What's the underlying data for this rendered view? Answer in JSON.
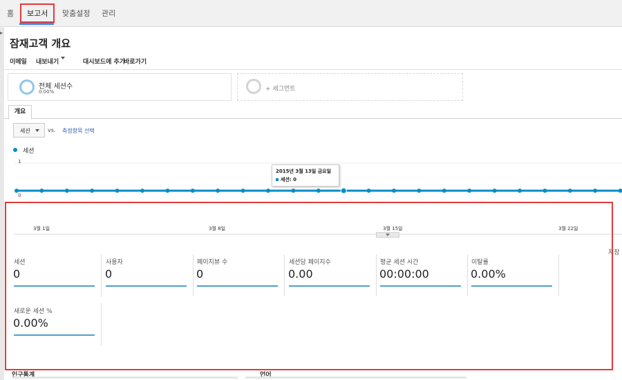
{
  "nav": {
    "tabs": [
      {
        "label": "홈"
      },
      {
        "label": "보고서"
      },
      {
        "label": "맞춤설정"
      },
      {
        "label": "관리"
      }
    ],
    "active_tab": "보고서",
    "accent_color": "#4285f4",
    "highlight_color": "#e53935"
  },
  "page": {
    "title": "잠재고객 개요"
  },
  "toolbar": {
    "email": "이메일",
    "export": "내보내기",
    "add_dashboard": "대시보드에 추가",
    "shortcut": "바로가기"
  },
  "segments": {
    "main_label": "전체 세션수",
    "main_value": "0.00%",
    "add_label": "+ 세그먼트"
  },
  "report_tabs": {
    "overview": "개요"
  },
  "chart_controls": {
    "metric": "세션",
    "vs": "vs.",
    "choose_metric": "측정항목 선택"
  },
  "chart_data": {
    "type": "line",
    "series": [
      {
        "name": "세션",
        "values": [
          0,
          0,
          0,
          0,
          0,
          0,
          0,
          0,
          0,
          0,
          0,
          0,
          0,
          0,
          0,
          0,
          0,
          0,
          0,
          0,
          0,
          0,
          0,
          0,
          0,
          0
        ]
      }
    ],
    "y_ticks": [
      "1",
      "0"
    ],
    "ylim": [
      0,
      1
    ],
    "x_tick_labels": [
      "3월 1일",
      "3월 8일",
      "3월 15일",
      "3월 22일"
    ],
    "color": "#058dc7",
    "tooltip": {
      "date": "2015년 3월 13일 금요일",
      "series_label": "세션: 0"
    }
  },
  "side_label": "저장",
  "metrics": [
    {
      "label": "세션",
      "value": "0"
    },
    {
      "label": "사용자",
      "value": "0"
    },
    {
      "label": "페이지뷰 수",
      "value": "0"
    },
    {
      "label": "세션당 페이지수",
      "value": "0.00"
    },
    {
      "label": "평균 세션 시간",
      "value": "00:00:00"
    },
    {
      "label": "이탈률",
      "value": "0.00%"
    },
    {
      "label": "새로운 세션 %",
      "value": "0.00%"
    }
  ],
  "bottom": {
    "demographics": "인구통계",
    "language": "언어"
  }
}
